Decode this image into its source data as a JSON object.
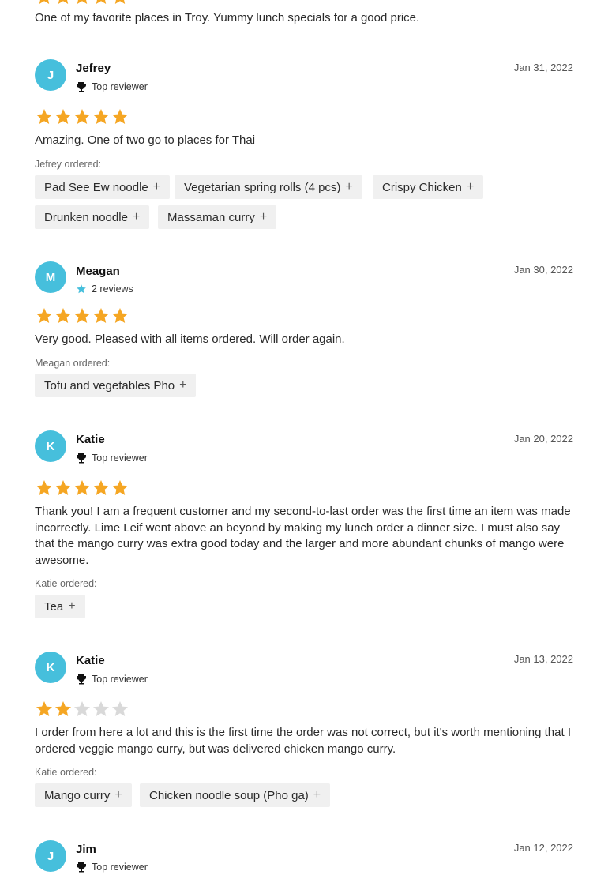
{
  "top_review": {
    "text": "One of my favorite places in Troy. Yummy lunch specials for a good price."
  },
  "reviews": [
    {
      "initial": "J",
      "name": "Jefrey",
      "badge": "Top reviewer",
      "badge_icon": "trophy-icon",
      "date": "Jan 31, 2022",
      "rating": 5,
      "text": "Amazing. One of two go to places for Thai",
      "ordered_label": "Jefrey ordered:",
      "items": [
        "Pad See Ew noodle",
        "Vegetarian spring rolls (4 pcs)",
        "Crispy Chicken",
        "Drunken noodle",
        "Massaman curry"
      ]
    },
    {
      "initial": "M",
      "name": "Meagan",
      "badge": "2 reviews",
      "badge_icon": "star-icon",
      "date": "Jan 30, 2022",
      "rating": 5,
      "text": "Very good. Pleased with all items ordered. Will order again.",
      "ordered_label": "Meagan ordered:",
      "items": [
        "Tofu and vegetables Pho"
      ]
    },
    {
      "initial": "K",
      "name": "Katie",
      "badge": "Top reviewer",
      "badge_icon": "trophy-icon",
      "date": "Jan 20, 2022",
      "rating": 5,
      "text": "Thank you! I am a frequent customer and my second-to-last order was the first time an item was made incorrectly. Lime Leif went above an beyond by making my lunch order a dinner size. I must also say that the mango curry was extra good today and the larger and more abundant chunks of mango were awesome.",
      "ordered_label": "Katie ordered:",
      "items": [
        "Tea"
      ]
    },
    {
      "initial": "K",
      "name": "Katie",
      "badge": "Top reviewer",
      "badge_icon": "trophy-icon",
      "date": "Jan 13, 2022",
      "rating": 2,
      "text": "I order from here a lot and this is the first time the order was not correct, but it's worth mentioning that I ordered veggie mango curry, but was delivered chicken mango curry.",
      "ordered_label": "Katie ordered:",
      "items": [
        "Mango curry",
        "Chicken noodle soup (Pho ga)"
      ]
    },
    {
      "initial": "J",
      "name": "Jim",
      "badge": "Top reviewer",
      "badge_icon": "trophy-icon",
      "date": "Jan 12, 2022"
    }
  ],
  "colors": {
    "avatar": "#46bfdc",
    "star_on": "#f5a623",
    "star_off": "#d9d9d9",
    "chip_bg": "#f0f0f0"
  }
}
